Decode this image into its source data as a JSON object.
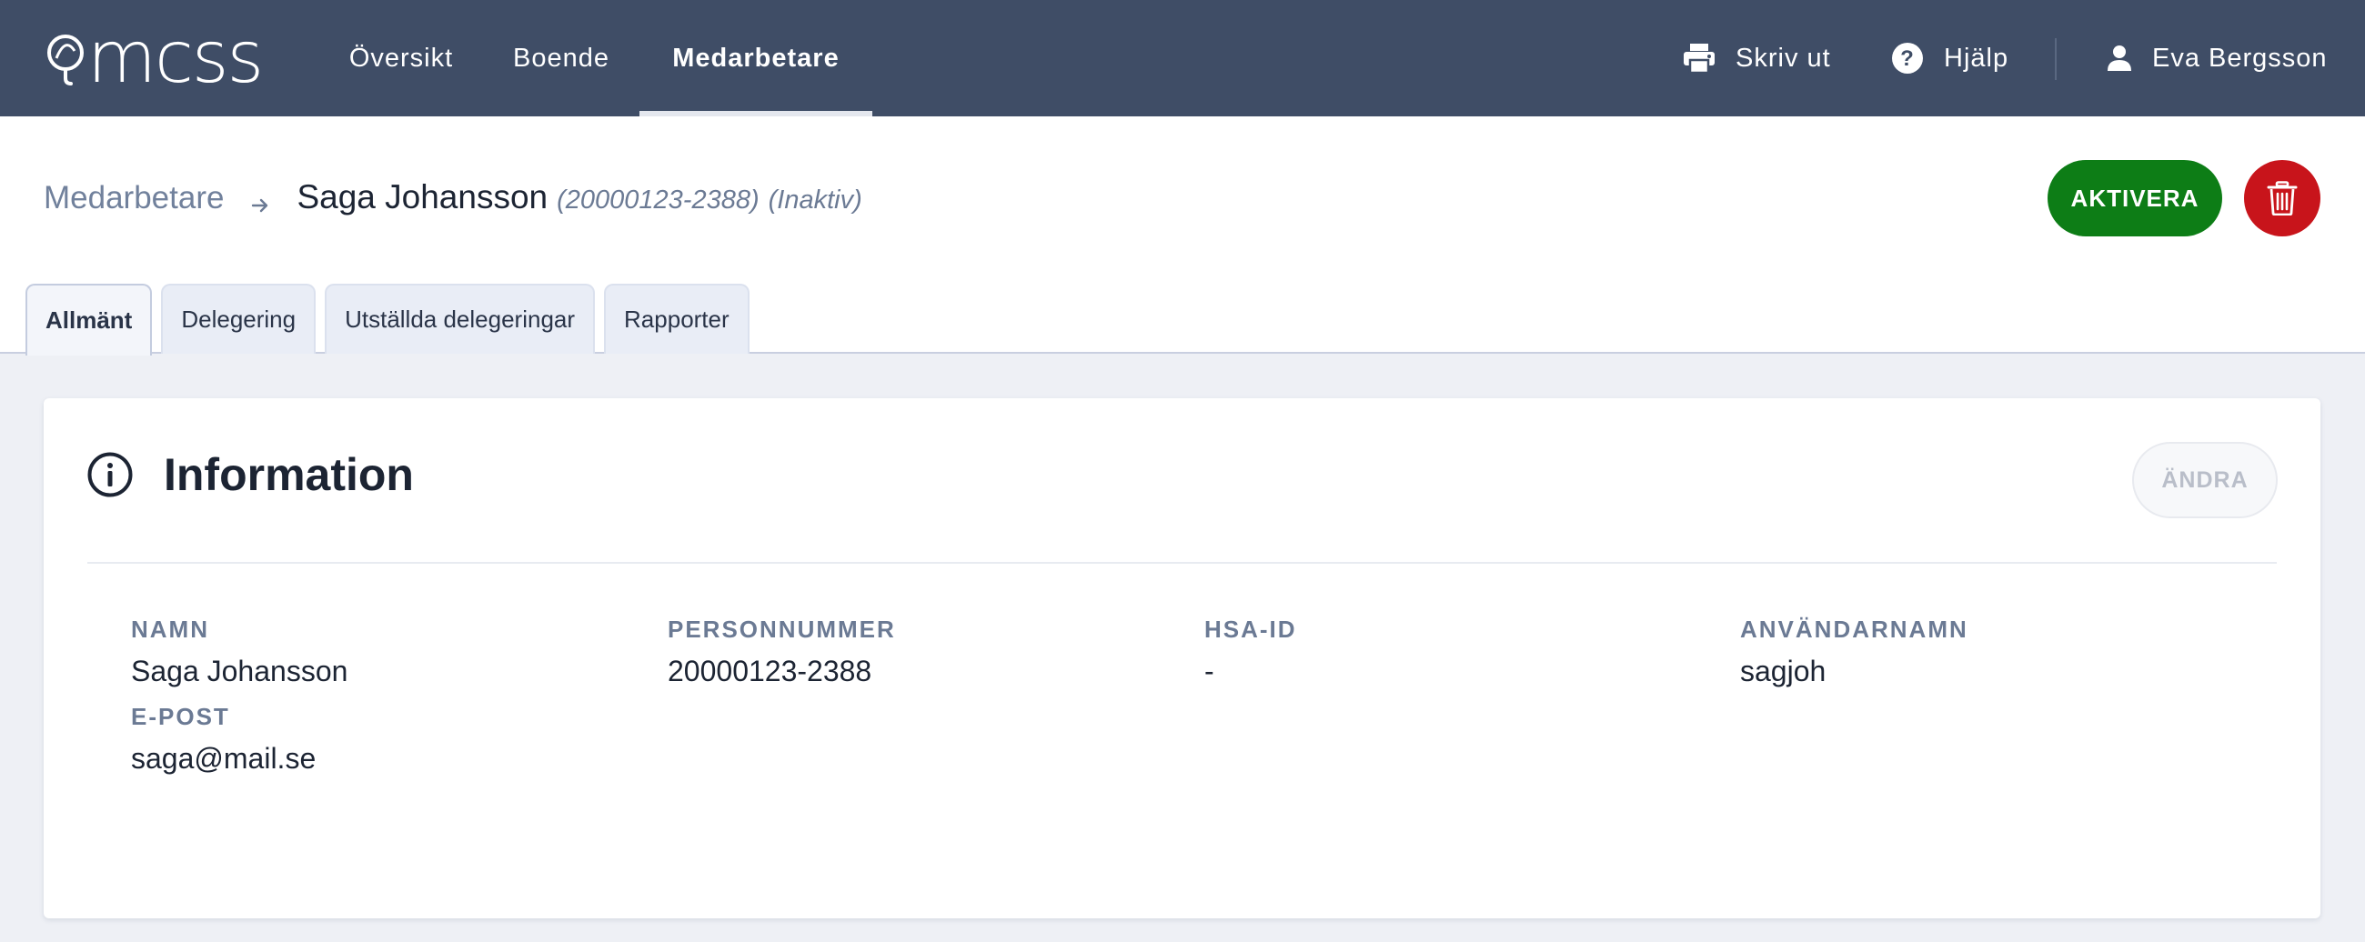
{
  "app": {
    "logo_text": "mcss"
  },
  "nav": {
    "items": [
      {
        "label": "Översikt"
      },
      {
        "label": "Boende"
      },
      {
        "label": "Medarbetare"
      }
    ],
    "print_label": "Skriv ut",
    "help_label": "Hjälp",
    "user_name": "Eva Bergsson"
  },
  "breadcrumb": {
    "parent": "Medarbetare",
    "current": "Saga Johansson",
    "id_text": "(20000123-2388)",
    "status_text": "(Inaktiv)"
  },
  "actions": {
    "activate_label": "AKTIVERA"
  },
  "tabs": [
    {
      "label": "Allmänt",
      "active": true
    },
    {
      "label": "Delegering",
      "active": false
    },
    {
      "label": "Utställda delegeringar",
      "active": false
    },
    {
      "label": "Rapporter",
      "active": false
    }
  ],
  "info": {
    "title": "Information",
    "edit_label": "ÄNDRA",
    "fields": [
      {
        "label": "NAMN",
        "value": "Saga Johansson"
      },
      {
        "label": "PERSONNUMMER",
        "value": "20000123-2388"
      },
      {
        "label": "HSA-ID",
        "value": "-"
      },
      {
        "label": "ANVÄNDARNAMN",
        "value": "sagjoh"
      },
      {
        "label": "E-POST",
        "value": "saga@mail.se"
      }
    ]
  },
  "colors": {
    "topbar": "#3f4d66",
    "activate": "#0d7d16",
    "delete": "#c8141b",
    "label": "#6b7a94"
  },
  "icons": [
    "logo-icon",
    "printer-icon",
    "help-icon",
    "user-icon",
    "arrow-right-icon",
    "trash-icon",
    "info-icon"
  ]
}
